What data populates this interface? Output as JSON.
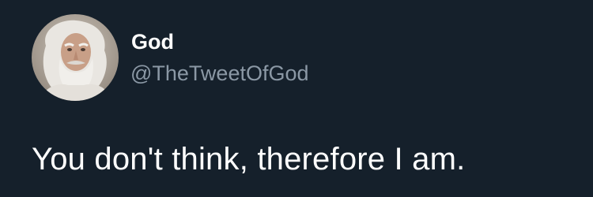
{
  "tweet": {
    "author": {
      "display_name": "God",
      "handle": "@TheTweetOfGod",
      "avatar_icon": "bearded-elder-portrait-avatar"
    },
    "text": "You don't think, therefore I am."
  },
  "colors": {
    "background": "#15202b",
    "primary_text": "#ffffff",
    "secondary_text": "#8b98a5"
  }
}
